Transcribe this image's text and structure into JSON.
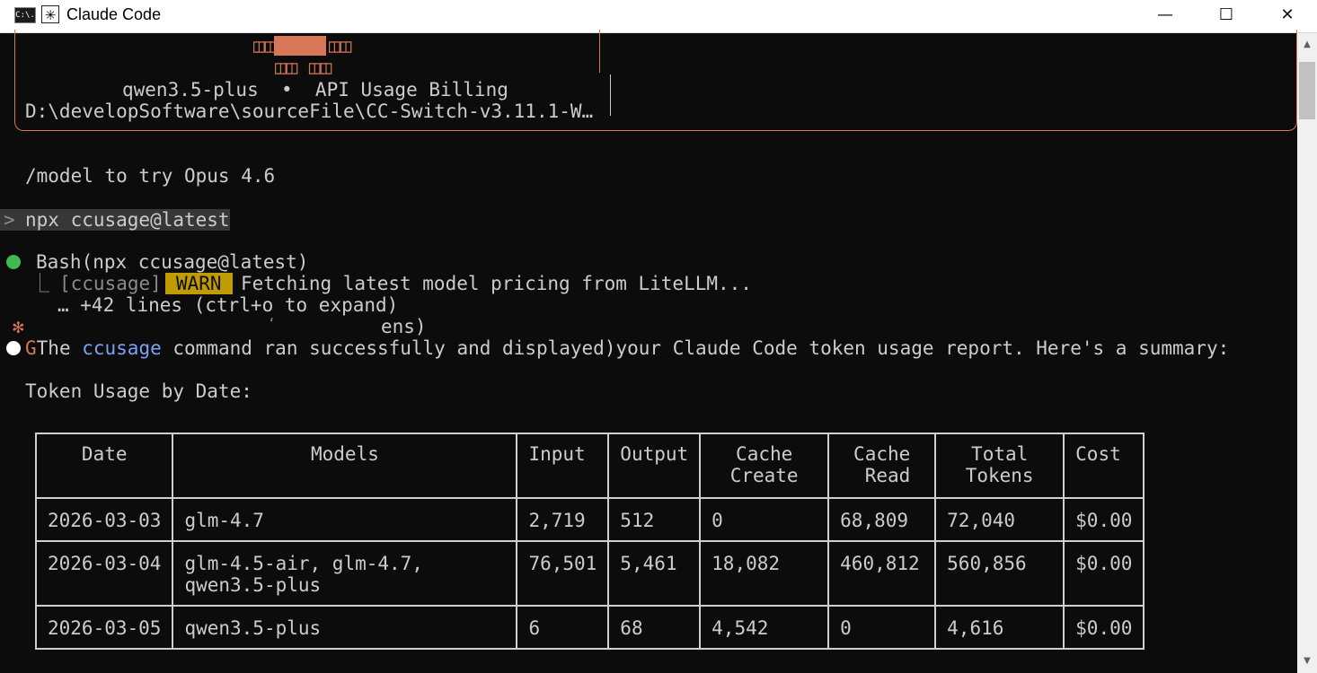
{
  "window": {
    "title": "Claude Code",
    "app_icon": "cmd-icon",
    "app_icon_text": "C:\\.",
    "title_icon": "claude-asterisk-icon",
    "title_icon_glyph": "✳",
    "minimize_glyph": "—",
    "maximize_glyph": "☐",
    "close_glyph": "✕"
  },
  "welcome": {
    "mascot_row1_left": "◫◫",
    "mascot_row1_right": "◫◫",
    "mascot_row2": "◫◫ ◫◫",
    "model_line": "qwen3.5-plus  •  API Usage Billing",
    "path_line": "D:\\developSoftware\\sourceFile\\CC-Switch-v3.11.1-W…"
  },
  "tip": "/model to try Opus 4.6",
  "prompt": {
    "marker": ">",
    "command": "npx ccusage@latest"
  },
  "tool_call": {
    "status_color": "#3fb950",
    "label": "Bash(npx ccusage@latest)",
    "output_branch": "⎿",
    "output_tag": "[ccusage]",
    "warn_badge": "WARN",
    "output_text": "Fetching latest model pricing from LiteLLM...",
    "more_lines": "… +42 lines (ctrl+o to expand)",
    "spinner_glyph": "✻",
    "artifact_tick": "‘",
    "artifact_text": "ens)"
  },
  "response": {
    "bullet_color": "#ffffff",
    "artifact_prefix": "G",
    "text_before": "The ",
    "highlight": "ccusage",
    "text_mid": " command ran successfully and displayed",
    "artifact_paren": ")",
    "text_after": "your Claude Code token usage report. Here's a summary:"
  },
  "section_heading": "Token Usage by Date:",
  "table": {
    "headers": [
      "Date",
      "Models",
      "Input",
      "Output",
      "Cache\nCreate",
      "Cache\n Read",
      "Total\nTokens",
      "Cost"
    ],
    "rows": [
      [
        "2026-03-03",
        "glm-4.7",
        "2,719",
        "512",
        "0",
        "68,809",
        "72,040",
        "$0.00"
      ],
      [
        "2026-03-04",
        "glm-4.5-air, glm-4.7,\nqwen3.5-plus",
        "76,501",
        "5,461",
        "18,082",
        "460,812",
        "560,856",
        "$0.00"
      ],
      [
        "2026-03-05",
        "qwen3.5-plus",
        "6",
        "68",
        "4,542",
        "0",
        "4,616",
        "$0.00"
      ]
    ]
  },
  "scrollbar": {
    "up_glyph": "▲",
    "down_glyph": "▼"
  }
}
